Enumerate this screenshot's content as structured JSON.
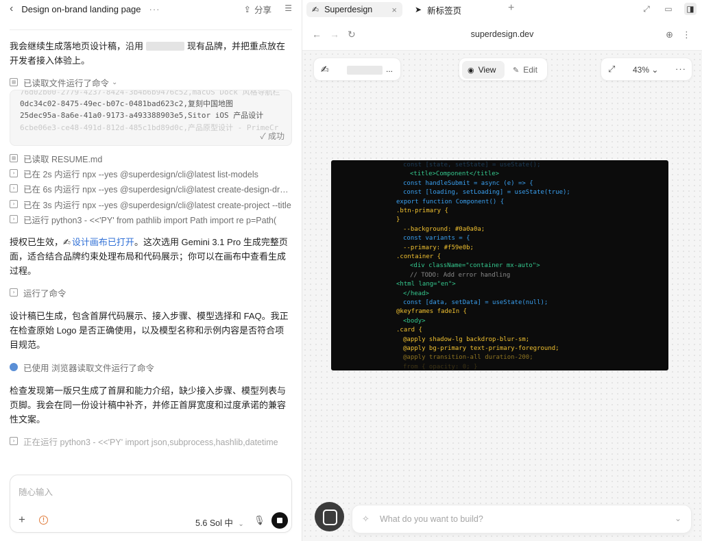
{
  "left": {
    "title": "Design on-brand landing page",
    "share_label": "分享",
    "intro_a": "我会继续生成落地页设计稿，沿用",
    "intro_b": "现有品牌，并把重点放在开发者接入体验上。",
    "step_read_cmd": "已读取文件运行了命令",
    "output_lines": [
      "76d02b00-2779-4237-8424-3b4b6b9476c52,macOS Dock 风格导航栏",
      "0dc34c02-8475-49ec-b07c-0481bad623c2,复刻中国地图",
      "25dec95a-8a6e-41a0-9173-a493388903e5,Sitor iOS 产品设计",
      "6cbe06e3-ce48-491d-812d-485c1bd89d0c,产品原型设计 - PrimeCr"
    ],
    "output_status": "✓ 成功",
    "steps": [
      "已读取 RESUME.md",
      "已在 2s 内运行 npx --yes @superdesign/cli@latest list-models",
      "已在 6s 内运行 npx --yes @superdesign/cli@latest create-design-draft --proj",
      "已在 3s 内运行 npx --yes @superdesign/cli@latest create-project --title",
      "已运行 python3 - <<'PY' from pathlib import Path import re p=Path("
    ],
    "auth_a": "授权已生效，",
    "auth_link": "设计画布已打开",
    "auth_b": "。这次选用 Gemini 3.1 Pro 生成完整页面，适合结合品牌约束处理布局和代码展示；你可以在画布中查看生成过程。",
    "ran_cmd": "运行了命令",
    "para2": "设计稿已生成，包含首屏代码展示、接入步骤、模型选择和 FAQ。我正在检查原始 Logo 是否正确使用，以及模型名称和示例内容是否符合项目规范。",
    "used_browser": "已使用 浏览器读取文件运行了命令",
    "para3": "检查发现第一版只生成了首屏和能力介绍，缺少接入步骤、模型列表与页脚。我会在同一份设计稿中补齐，并修正首屏宽度和过度承诺的兼容性文案。",
    "running": "正在运行 python3 - <<'PY' import json,subprocess,hashlib,datetime",
    "composer_placeholder": "随心输入",
    "model_label": "5.6 Sol 中"
  },
  "right": {
    "tab_active": "Superdesign",
    "tab_new": "新标签页",
    "url": "superdesign.dev",
    "view_label": "View",
    "edit_label": "Edit",
    "zoom": "43%",
    "prompt_placeholder": "What do you want to build?",
    "code_lines": [
      {
        "t": "const [state, setState] = useState();",
        "c": "#3a8fd9",
        "i": 1,
        "o": 0.35
      },
      {
        "t": "<title>Component</title>",
        "c": "#35c98f",
        "i": 2,
        "o": 1
      },
      {
        "t": "const handleSubmit = async (e) => {",
        "c": "#3aa0f0",
        "i": 1,
        "o": 1
      },
      {
        "t": "const [loading, setLoading] = useState(true);",
        "c": "#3aa0f0",
        "i": 1,
        "o": 1
      },
      {
        "t": "export function Component() {",
        "c": "#3aa0f0",
        "i": 0,
        "o": 1
      },
      {
        "t": ".btn-primary {",
        "c": "#f2c230",
        "i": 0,
        "o": 1
      },
      {
        "t": "}",
        "c": "#f2c230",
        "i": 0,
        "o": 1
      },
      {
        "t": "--background: #0a0a0a;",
        "c": "#f2c230",
        "i": 1,
        "o": 1
      },
      {
        "t": "const variants = {",
        "c": "#3aa0f0",
        "i": 1,
        "o": 1
      },
      {
        "t": "--primary: #f59e0b;",
        "c": "#f2c230",
        "i": 1,
        "o": 1
      },
      {
        "t": ".container {",
        "c": "#f2c230",
        "i": 0,
        "o": 1
      },
      {
        "t": "<div className=\"container mx-auto\">",
        "c": "#35c98f",
        "i": 2,
        "o": 1
      },
      {
        "t": "// TODO: Add error handling",
        "c": "#8a8a8a",
        "i": 2,
        "o": 1
      },
      {
        "t": "<html lang=\"en\">",
        "c": "#35c98f",
        "i": 0,
        "o": 1
      },
      {
        "t": "</head>",
        "c": "#35c98f",
        "i": 1,
        "o": 1
      },
      {
        "t": "const [data, setData] = useState(null);",
        "c": "#3aa0f0",
        "i": 1,
        "o": 1
      },
      {
        "t": "@keyframes fadeIn {",
        "c": "#f2c230",
        "i": 0,
        "o": 1
      },
      {
        "t": "<body>",
        "c": "#35c98f",
        "i": 1,
        "o": 1
      },
      {
        "t": ".card {",
        "c": "#f2c230",
        "i": 0,
        "o": 1
      },
      {
        "t": "@apply shadow-lg backdrop-blur-sm;",
        "c": "#f2c230",
        "i": 1,
        "o": 1
      },
      {
        "t": "@apply bg-primary text-primary-foreground;",
        "c": "#f2c230",
        "i": 1,
        "o": 1
      },
      {
        "t": "@apply transition-all duration-200;",
        "c": "#f2c230",
        "i": 1,
        "o": 0.55
      },
      {
        "t": "from { opacity: 0; }",
        "c": "#f2c230",
        "i": 1,
        "o": 0.2
      }
    ]
  }
}
